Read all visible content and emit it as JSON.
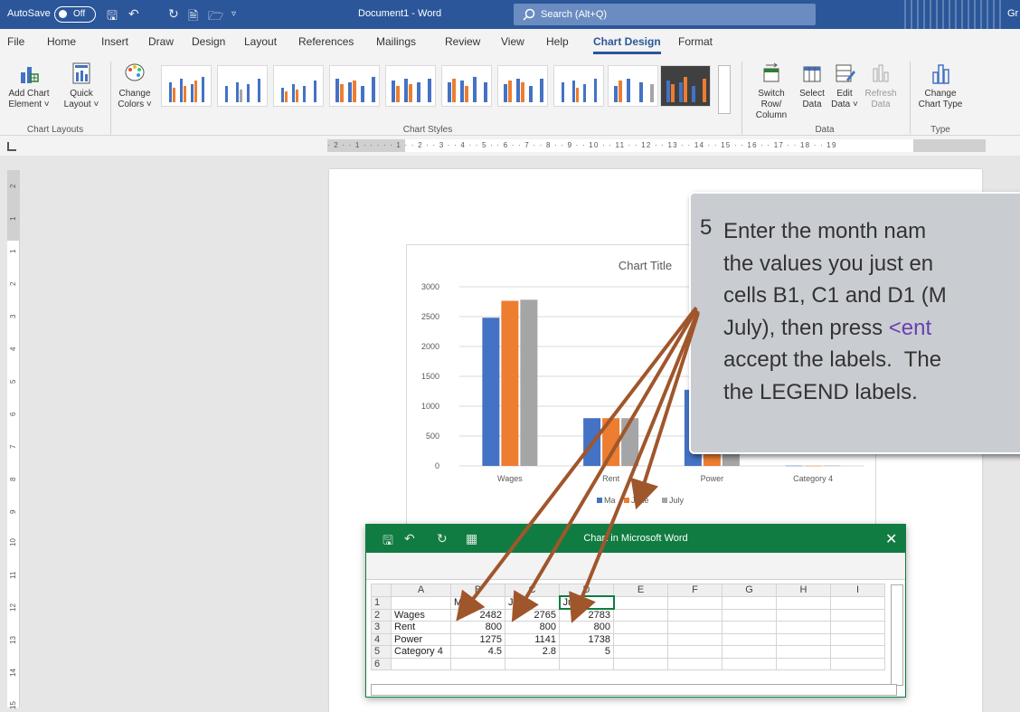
{
  "titlebar": {
    "autosave_label": "AutoSave",
    "autosave_state": "Off",
    "document": "Document1  -  Word",
    "search_placeholder": "Search (Alt+Q)",
    "user_initials": "Gr"
  },
  "ribbon_tabs": [
    "File",
    "Home",
    "Insert",
    "Draw",
    "Design",
    "Layout",
    "References",
    "Mailings",
    "Review",
    "View",
    "Help",
    "Chart Design",
    "Format"
  ],
  "active_tab": "Chart Design",
  "ribbon": {
    "add_chart_element": [
      "Add Chart",
      "Element ˅"
    ],
    "quick_layout": [
      "Quick",
      "Layout ˅"
    ],
    "change_colors": [
      "Change",
      "Colors ˅"
    ],
    "switch_row_column": [
      "Switch Row/",
      "Column"
    ],
    "select_data": [
      "Select",
      "Data"
    ],
    "edit_data": [
      "Edit",
      "Data ˅"
    ],
    "refresh_data": [
      "Refresh",
      "Data"
    ],
    "change_chart_type": [
      "Change",
      "Chart Type"
    ],
    "groups": {
      "chart_layouts": "Chart Layouts",
      "chart_styles": "Chart Styles",
      "data": "Data",
      "type": "Type"
    }
  },
  "ruler": {
    "horizontal": "· 2 · · 1 · · · · · 1 · · 2 · · 3 · · 4 · · 5 · · 6 · · 7 · · 8 · · 9 · · 10 · · 11 · · 12 · · 13 · · 14 · · 15 · · 16 · · 17 · · 18 · · 19",
    "vertical": [
      "2",
      "1",
      "1",
      "2",
      "3",
      "4",
      "5",
      "6",
      "7",
      "8",
      "9",
      "10",
      "11",
      "12",
      "13",
      "14",
      "15"
    ]
  },
  "chart_data": {
    "type": "bar",
    "title": "Chart Title",
    "categories": [
      "Wages",
      "Rent",
      "Power",
      "Category 4"
    ],
    "ylim": [
      0,
      3000
    ],
    "yticks": [
      0,
      500,
      1000,
      1500,
      2000,
      2500,
      3000
    ],
    "grid": true,
    "legend_position": "bottom",
    "series": [
      {
        "name": "May",
        "color": "#4472c4",
        "values": [
          2482,
          800,
          1275,
          4.5
        ]
      },
      {
        "name": "June",
        "color": "#ed7d31",
        "values": [
          2765,
          800,
          1141,
          2.8
        ]
      },
      {
        "name": "July",
        "color": "#a5a5a5",
        "values": [
          2783,
          800,
          1738,
          5
        ]
      }
    ],
    "legend_labels_visible": [
      "Ma",
      "June",
      "July"
    ]
  },
  "callout": {
    "number": "5",
    "lines": [
      "Enter the month nam",
      "the values you just en",
      "cells B1, C1 and D1 (M",
      "July), then press ",
      "accept the labels.  The",
      "the LEGEND labels."
    ],
    "highlight": "<ent"
  },
  "excel": {
    "title": "Chart in Microsoft Word",
    "columns": [
      "A",
      "B",
      "C",
      "D",
      "E",
      "F",
      "G",
      "H",
      "I"
    ],
    "rows": [
      [
        "1",
        "",
        "May",
        "June",
        "July"
      ],
      [
        "2",
        "Wages",
        "2482",
        "2765",
        "2783"
      ],
      [
        "3",
        "Rent",
        "800",
        "800",
        "800"
      ],
      [
        "4",
        "Power",
        "1275",
        "1141",
        "1738"
      ],
      [
        "5",
        "Category 4",
        "4.5",
        "2.8",
        "5"
      ],
      [
        "6",
        "",
        "",
        "",
        ""
      ]
    ]
  }
}
